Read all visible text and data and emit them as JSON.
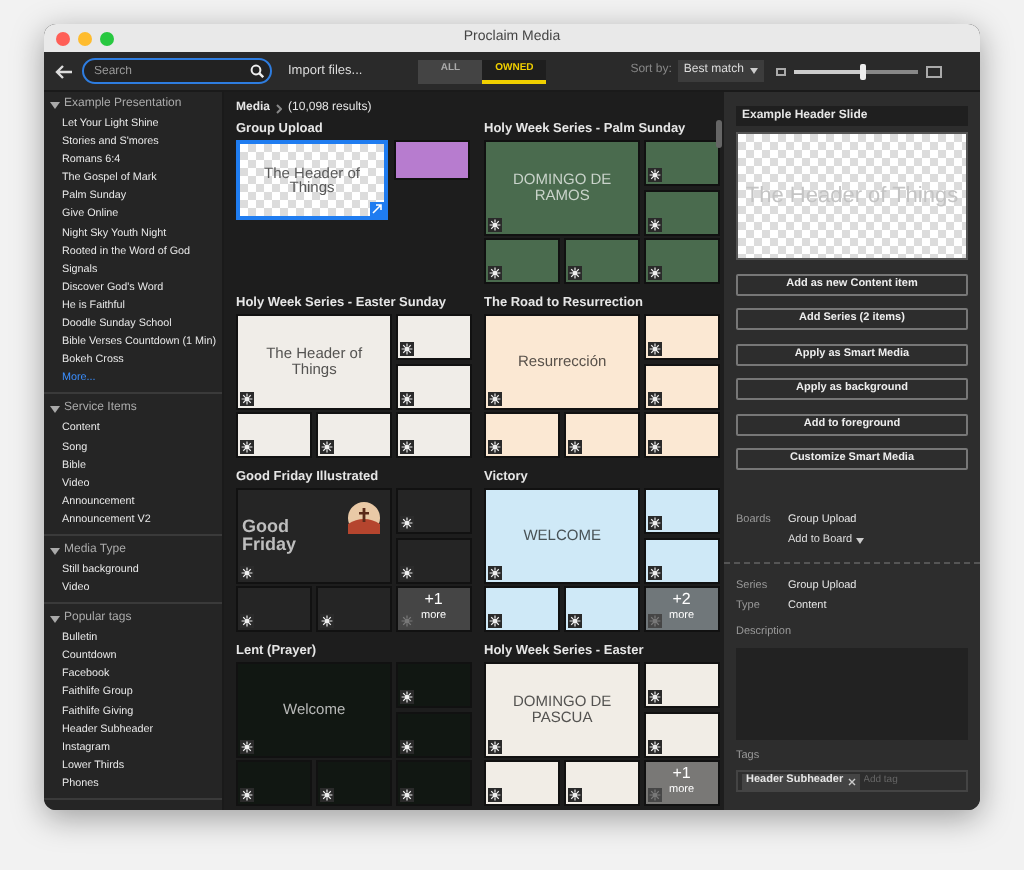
{
  "window": {
    "title": "Proclaim Media"
  },
  "toolbar": {
    "search": {
      "placeholder": "Search"
    },
    "import": "Import files...",
    "filters": [
      {
        "label": "ALL",
        "selected": false
      },
      {
        "label": "OWNED",
        "selected": true
      }
    ],
    "sort_label": "Sort by:",
    "sort_value": "Best match",
    "size_slider": {
      "level": 0.55
    }
  },
  "sidebar": {
    "sections": [
      {
        "title": "Example Presentation",
        "expanded": true,
        "items": [
          "Let Your Light Shine",
          "Stories and S'mores",
          "Romans 6:4",
          "The Gospel of Mark",
          "Palm Sunday",
          "Give Online",
          "Night Sky Youth Night",
          "Rooted in the Word of God",
          "Signals",
          "Discover God's Word",
          "He is Faithful",
          "Doodle Sunday School",
          "Bible Verses Countdown (1 Min)",
          "Bokeh Cross"
        ],
        "more": "More..."
      },
      {
        "title": "Service Items",
        "expanded": true,
        "items": [
          "Content",
          "Song",
          "Bible",
          "Video",
          "Announcement",
          "Announcement V2"
        ]
      },
      {
        "title": "Media Type",
        "expanded": true,
        "items": [
          "Still background",
          "Video"
        ]
      },
      {
        "title": "Popular tags",
        "expanded": true,
        "items": [
          "Bulletin",
          "Countdown",
          "Facebook",
          "Faithlife Group",
          "Faithlife Giving",
          "Header Subheader",
          "Instagram",
          "Lower Thirds",
          "Phones"
        ]
      }
    ]
  },
  "breadcrumb": {
    "root": "Media",
    "count": "(10,098 results)"
  },
  "groups": [
    {
      "kind": "pair",
      "title": "Group Upload",
      "tiles": [
        {
          "kind": "transparent",
          "headline": "The Header of Things",
          "selected": true
        },
        {
          "kind": "solid",
          "color": "#b77ccf",
          "selected": false
        }
      ]
    },
    {
      "kind": "grid",
      "title": "Holy Week Series - Palm Sunday",
      "color": "#4a6b4e",
      "headline": "DOMINGO DE RAMOS"
    },
    {
      "kind": "grid",
      "title": "Holy Week Series - Easter Sunday",
      "color": "#f0ede8",
      "headline": "The Header of Things"
    },
    {
      "kind": "grid",
      "title": "The Road to Resurrection",
      "color": "#fbe8d3",
      "headline": "Resurrección"
    },
    {
      "kind": "grid",
      "title": "Good Friday Illustrated",
      "color": "#252525",
      "headline": "Good Friday",
      "more_count": "+1",
      "more_label": "more"
    },
    {
      "kind": "grid",
      "title": "Victory",
      "color": "#cfe9f7",
      "headline": "WELCOME",
      "more_count": "+2",
      "more_label": "more"
    },
    {
      "kind": "grid",
      "title": "Lent (Prayer)",
      "color": "#111712",
      "headline": "Welcome"
    },
    {
      "kind": "grid",
      "title": "Holy Week Series - Easter",
      "color": "#f1ede6",
      "headline": "DOMINGO DE PASCUA",
      "more_count": "+1",
      "more_label": "more"
    }
  ],
  "detail": {
    "title": "Example Header Slide",
    "preview": {
      "headline": "The Header of Things"
    },
    "actions": [
      "Add as new Content item",
      "Add Series (2 items)",
      "Apply as Smart Media",
      "Apply as background",
      "Add to foreground",
      "Customize Smart Media"
    ],
    "boards": {
      "label": "Boards",
      "value": "Group Upload",
      "add": "Add to Board"
    },
    "fields": [
      {
        "label": "Series",
        "value": "Group Upload"
      },
      {
        "label": "Type",
        "value": "Content"
      }
    ],
    "description": {
      "label": "Description"
    },
    "tags": {
      "label": "Tags",
      "items": [
        "Header Subheader"
      ],
      "placeholder": "Add tag"
    }
  }
}
